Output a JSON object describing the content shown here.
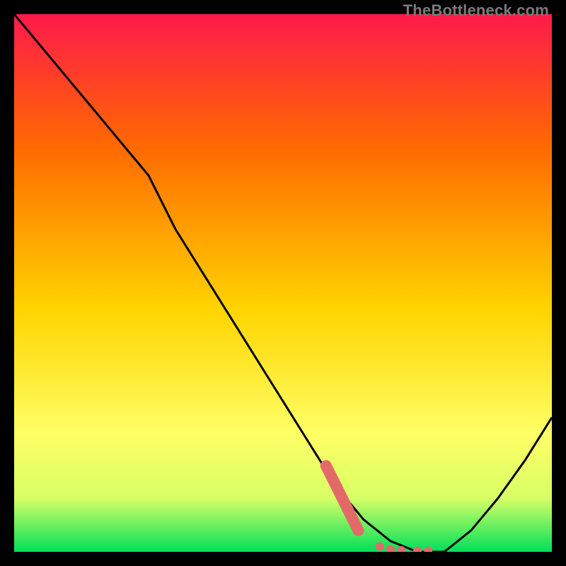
{
  "watermark": {
    "text": "TheBottleneck.com"
  },
  "colors": {
    "bg": "#000000",
    "gradient_top": "#ff1a4b",
    "gradient_mid1": "#ff6a00",
    "gradient_mid2": "#ffd400",
    "gradient_mid3": "#ffff66",
    "gradient_bottom": "#00e05a",
    "curve": "#000000",
    "marker": "#e46a6a"
  },
  "chart_data": {
    "type": "line",
    "title": "",
    "xlabel": "",
    "ylabel": "",
    "xlim": [
      0,
      100
    ],
    "ylim": [
      0,
      100
    ],
    "grid": false,
    "legend": false,
    "series": [
      {
        "name": "bottleneck-curve",
        "x": [
          0,
          5,
          10,
          15,
          20,
          25,
          30,
          35,
          40,
          45,
          50,
          55,
          60,
          65,
          70,
          75,
          80,
          85,
          90,
          95,
          100
        ],
        "values": [
          100,
          94,
          88,
          82,
          76,
          70,
          60,
          52,
          44,
          36,
          28,
          20,
          12,
          6,
          2,
          0,
          0,
          4,
          10,
          17,
          25
        ]
      }
    ],
    "markers": {
      "name": "highlighted-points",
      "x": [
        58,
        59,
        60,
        61,
        62,
        63,
        64,
        68,
        70,
        72,
        75,
        77
      ],
      "values": [
        16,
        14,
        12,
        10,
        8,
        6,
        4,
        1,
        0.5,
        0.3,
        0.2,
        0.2
      ]
    },
    "annotations": []
  }
}
